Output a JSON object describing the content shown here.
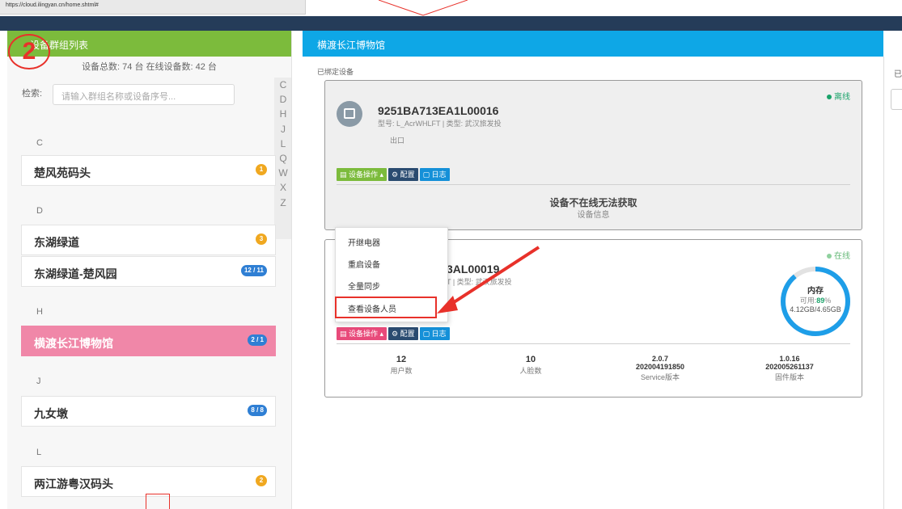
{
  "browser": {
    "url": "https://cloud.ilingyan.cn/home.shtml#"
  },
  "annotation": {
    "step_number": "2"
  },
  "left_panel": {
    "title": "设备群组列表",
    "stats": "设备总数: 74 台 在线设备数: 42 台",
    "search_label": "检索:",
    "search_placeholder": "请输入群组名称或设备序号...",
    "alpha_index": [
      "C",
      "D",
      "H",
      "J",
      "L",
      "Q",
      "W",
      "X",
      "Z"
    ],
    "sections": [
      {
        "letter": "C",
        "groups": [
          {
            "name": "楚风苑码头",
            "badge": "1",
            "badge_color": "#f0a820"
          }
        ]
      },
      {
        "letter": "D",
        "groups": [
          {
            "name": "东湖绿道",
            "badge": "3",
            "badge_color": "#f0a820"
          },
          {
            "name": "东湖绿道-楚风园",
            "badge": "12 / 11",
            "badge_color": "#2f7fd4"
          }
        ]
      },
      {
        "letter": "H",
        "groups": [
          {
            "name": "横渡长江博物馆",
            "badge": "2 / 1",
            "badge_color": "#2f7fd4"
          }
        ]
      },
      {
        "letter": "J",
        "groups": [
          {
            "name": "九女墩",
            "badge": "8 / 8",
            "badge_color": "#2f7fd4"
          }
        ]
      },
      {
        "letter": "L",
        "groups": [
          {
            "name": "两江游粤汉码头",
            "badge": "2",
            "badge_color": "#f0a820"
          }
        ]
      }
    ],
    "active_group": "横渡长江博物馆"
  },
  "right_panel": {
    "title": "横渡长江博物馆",
    "bound_label": "已绑定设备",
    "far_right_label": "已",
    "card1": {
      "serial": "9251BA713EA1L00016",
      "meta": "型号: L_AcrWHLFT | 类型: 武汉旅发投",
      "meta2": "出口",
      "status": "离线",
      "status_color": "#1aa36a",
      "btn_ops": "设备操作 ▴",
      "btn_config": "配置",
      "btn_log": "日志",
      "offline_main": "设备不在线无法获取",
      "offline_sub": "设备信息"
    },
    "card2": {
      "serial": "3AL00019",
      "meta": "T | 类型: 武汉旅发投",
      "status": "在线",
      "status_color": "#8fd19e",
      "btn_ops": "设备操作 ▴",
      "btn_config": "配置",
      "btn_log": "日志",
      "memory": {
        "title": "内存",
        "available_label": "可用:",
        "available_pct": "89",
        "pct_sign": "%",
        "usage": "4.12GB/4.65GB",
        "fraction": 0.89
      },
      "stats": [
        {
          "value": "12",
          "label": "用户数"
        },
        {
          "value": "10",
          "label": "人脸数"
        },
        {
          "value": "2.0.7",
          "value2": "202004191850",
          "label": "Service版本"
        },
        {
          "value": "1.0.16",
          "value2": "202005261137",
          "label": "固件版本"
        }
      ]
    },
    "dropdown": {
      "items": [
        "开继电器",
        "重启设备",
        "全量同步",
        "查看设备人员"
      ],
      "highlighted": "查看设备人员"
    }
  }
}
